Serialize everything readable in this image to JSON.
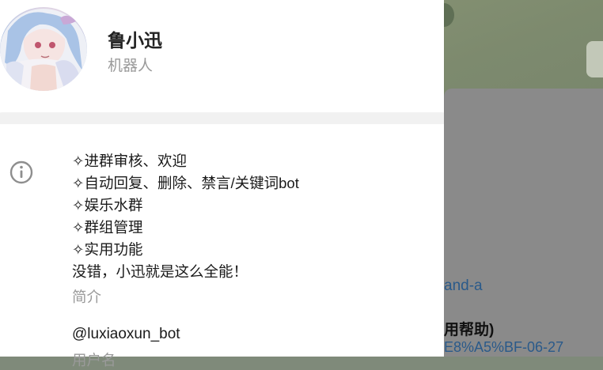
{
  "profile": {
    "name": "鲁小迅",
    "type_label": "机器人"
  },
  "bio": {
    "lines": [
      "✧进群审核、欢迎",
      "✧自动回复、删除、禁言/关键词bot",
      "✧娱乐水群",
      "✧群组管理",
      "✧实用功能",
      "没错，小迅就是这么全能！"
    ],
    "label": "简介"
  },
  "username": {
    "value": "@luxiaoxun_bot",
    "label": "用户名"
  },
  "background_chat": {
    "link_fragment": "and-a",
    "bold_fragment": "用帮助)",
    "link_fragment_2": "E8%A5%BF-06-27"
  },
  "icons": {
    "info": "info-icon"
  },
  "colors": {
    "secondary_text": "#9a9a9a",
    "primary_text": "#1a1a1a",
    "link": "#2a5a8a"
  }
}
